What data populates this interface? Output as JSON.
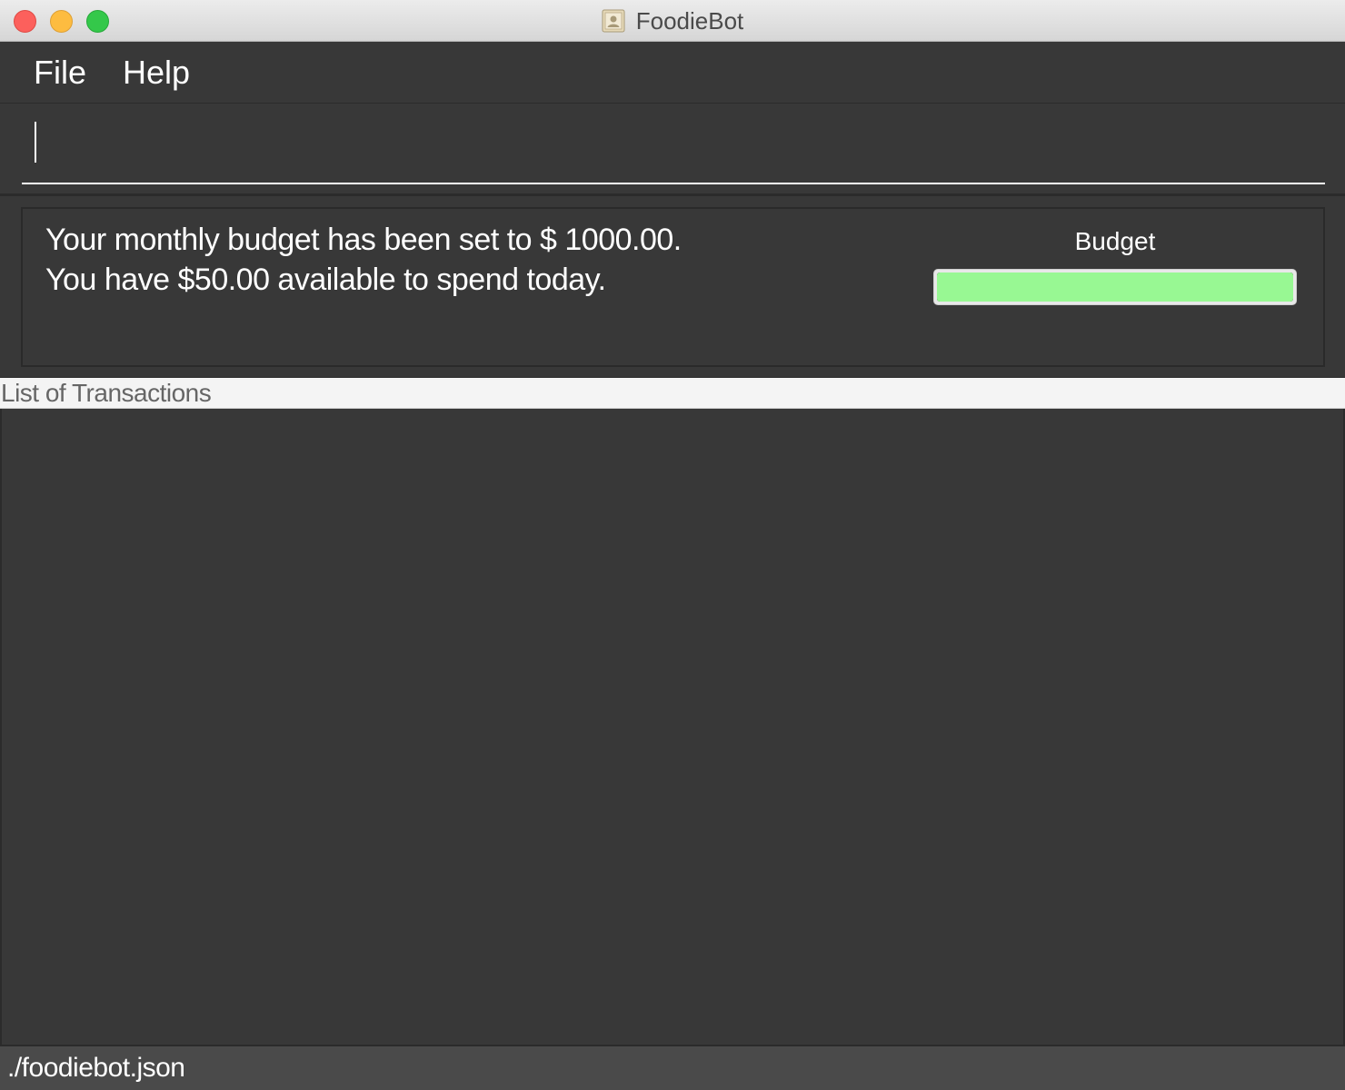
{
  "window": {
    "title": "FoodieBot",
    "app_icon": "contact-card-icon"
  },
  "menu": {
    "items": [
      {
        "label": "File"
      },
      {
        "label": "Help"
      }
    ]
  },
  "command_box": {
    "value": "",
    "placeholder": ""
  },
  "result_display": {
    "lines": [
      "Your monthly budget has been set to $ 1000.00.",
      "You have $50.00 available to spend today."
    ]
  },
  "budget": {
    "label": "Budget",
    "progress_fraction": 1.0,
    "fill_color": "#98f893"
  },
  "transactions": {
    "header": "List of Transactions",
    "items": []
  },
  "status_bar": {
    "file_path": "./foodiebot.json"
  },
  "colors": {
    "background": "#383838",
    "close": "#fc605c",
    "minimize": "#fdbc40",
    "maximize": "#34c84a"
  }
}
